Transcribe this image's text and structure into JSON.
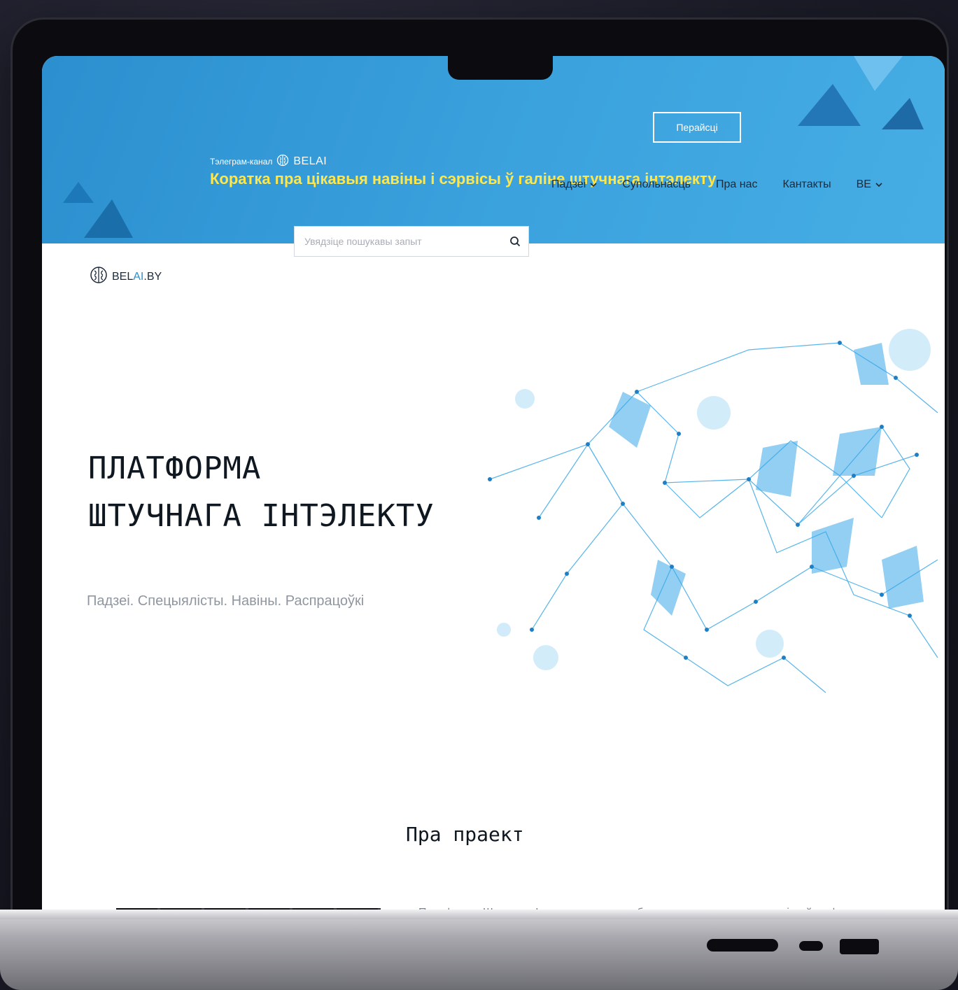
{
  "banner": {
    "label": "Тэлеграм-канал",
    "logo_text": "BELAI",
    "headline": "Коратка пра цікавыя навіны і сэрвісы ў галіне штучнага інтэлекту",
    "button_label": "Перайсці"
  },
  "brand": {
    "prefix": "BEL",
    "accent": "AI",
    "suffix": ".BY"
  },
  "search": {
    "placeholder": "Увядзіце пошукавы запыт"
  },
  "nav": {
    "items": [
      {
        "label": "Падзеі",
        "has_dropdown": true
      },
      {
        "label": "Супольнасць",
        "has_dropdown": false
      },
      {
        "label": "Пра нас",
        "has_dropdown": false
      },
      {
        "label": "Кантакты",
        "has_dropdown": false
      },
      {
        "label": "BE",
        "has_dropdown": true
      }
    ]
  },
  "hero": {
    "title_line1": "ПЛАТФОРМА",
    "title_line2": "ШТУЧНАГА ІНТЭЛЕКТУ",
    "subtitle": "Падзеі. Спецыялісты. Навіны. Распрацоўкі"
  },
  "about": {
    "title": "Пра праект",
    "text": "Платформа Штучнага Інтэлекту — гэта вэб-прыкладанне для спецыялістаў у сферы штучнага інтэлекту і ўсіх, хто цікавіцца гэтай сферай. Платформа змяшчае:"
  },
  "colors": {
    "banner_blue": "#3aa1dd",
    "headline_yellow": "#ffe74a",
    "accent_blue": "#2c8fcf",
    "text_dark": "#0f1720",
    "text_muted": "#8f96a0"
  }
}
